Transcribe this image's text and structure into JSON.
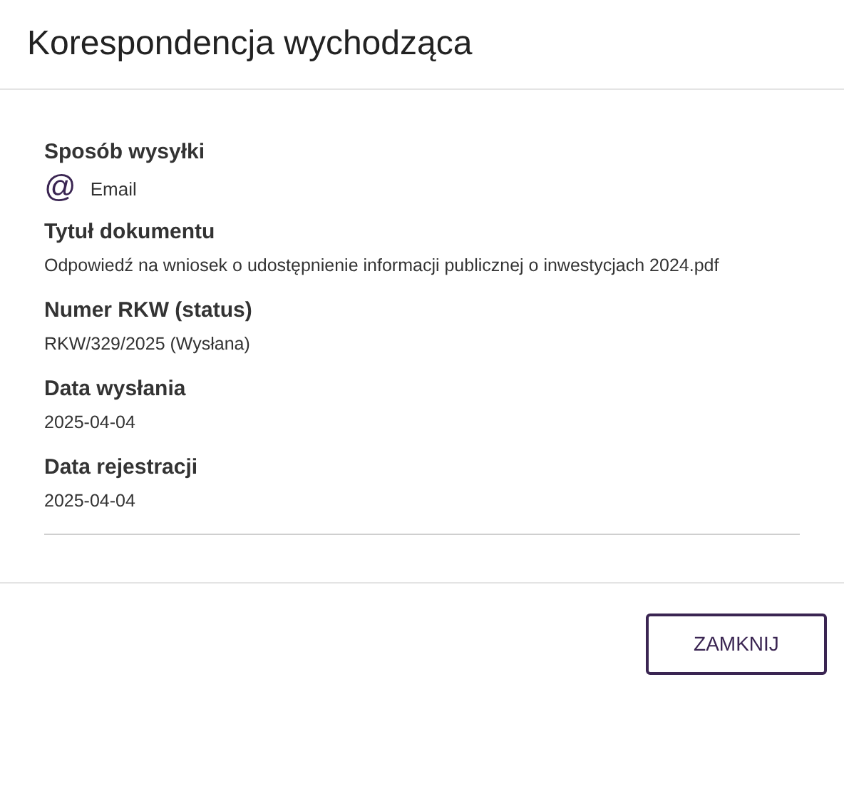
{
  "dialog": {
    "title": "Korespondencja wychodząca",
    "fields": [
      {
        "kind": "method",
        "label": "Sposób wysyłki",
        "icon": "@",
        "value": "Email"
      },
      {
        "kind": "text",
        "label": "Tytuł dokumentu",
        "value": "Odpowiedź na wniosek o udostępnienie informacji publicznej o inwestycjach 2024.pdf"
      },
      {
        "kind": "text",
        "label": "Numer RKW (status)",
        "value": "RKW/329/2025 (Wysłana)"
      },
      {
        "kind": "text",
        "label": "Data wysłania",
        "value": "2025-04-04"
      },
      {
        "kind": "text",
        "label": "Data rejestracji",
        "value": "2025-04-04"
      }
    ],
    "buttons": [
      "ZAMKNIJ"
    ]
  }
}
